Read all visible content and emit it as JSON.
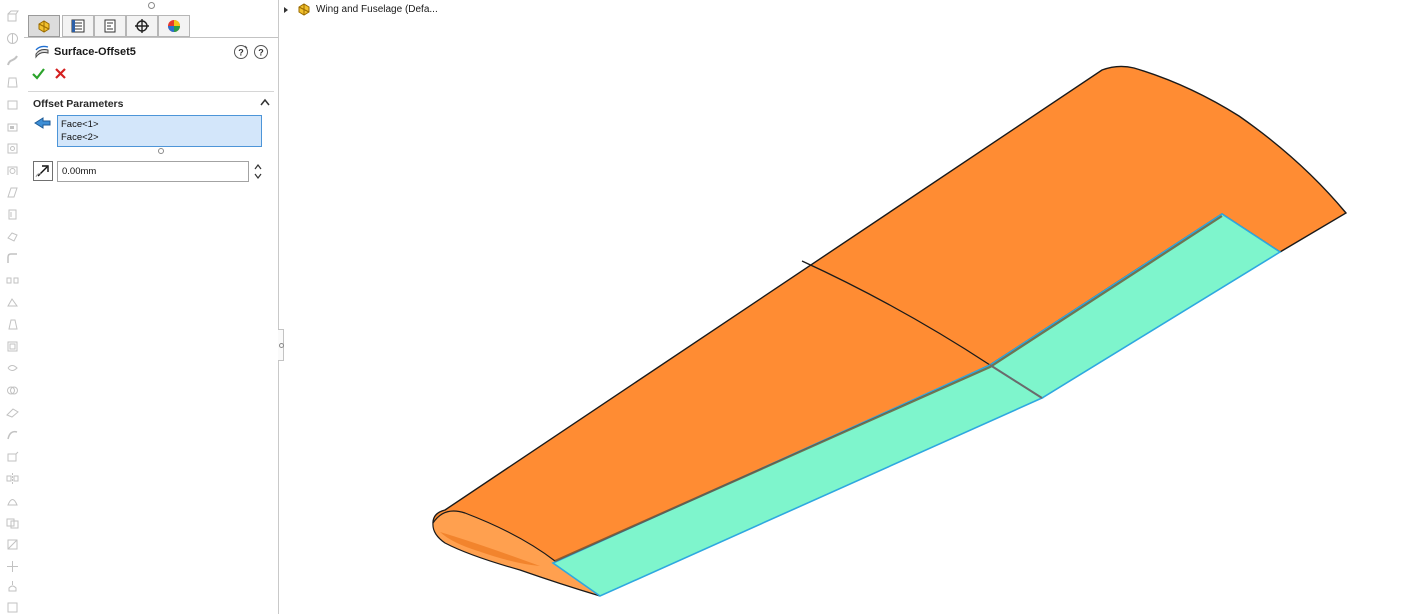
{
  "feature_tree": {
    "root_label": "Wing and Fuselage  (Defa..."
  },
  "property_manager": {
    "title": "Surface-Offset5",
    "section_title": "Offset Parameters",
    "faces": [
      "Face<1>",
      "Face<2>"
    ],
    "distance_value": "0.00mm",
    "tabs": [
      "featuremanager-icon",
      "propertymanager-icon",
      "configurationmanager-icon",
      "dimxpert-icon",
      "display-manager-icon"
    ]
  },
  "colors": {
    "wing_surface": "#FF8C33",
    "selected_face": "#7EF5CC",
    "selection_box": "#D3E6FA",
    "ok_green": "#2BA32B",
    "cancel_red": "#D42020"
  },
  "icons": {
    "ok": "checkmark-icon",
    "cancel": "x-icon",
    "help": "help-icon",
    "detailed_help": "question-icon",
    "collapse": "chevron-up-icon",
    "faces": "face-selection-icon",
    "distance": "reverse-direction-icon"
  }
}
